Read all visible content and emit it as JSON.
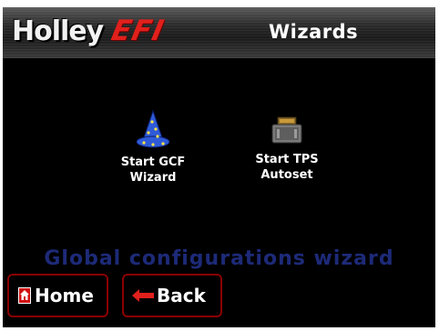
{
  "header": {
    "logo_holley": "Holley",
    "logo_efi": "EFI",
    "title": "Wizards"
  },
  "wizards": [
    {
      "line1": "Start GCF",
      "line2": "Wizard",
      "icon": "wizard-hat-icon"
    },
    {
      "line1": "Start TPS",
      "line2": "Autoset",
      "icon": "throttle-body-icon"
    }
  ],
  "description": "Global configurations wizard",
  "buttons": {
    "home": "Home",
    "back": "Back"
  },
  "colors": {
    "accent_red": "#e0201c",
    "description_blue": "#1d2a78",
    "button_border": "#8b0000"
  }
}
